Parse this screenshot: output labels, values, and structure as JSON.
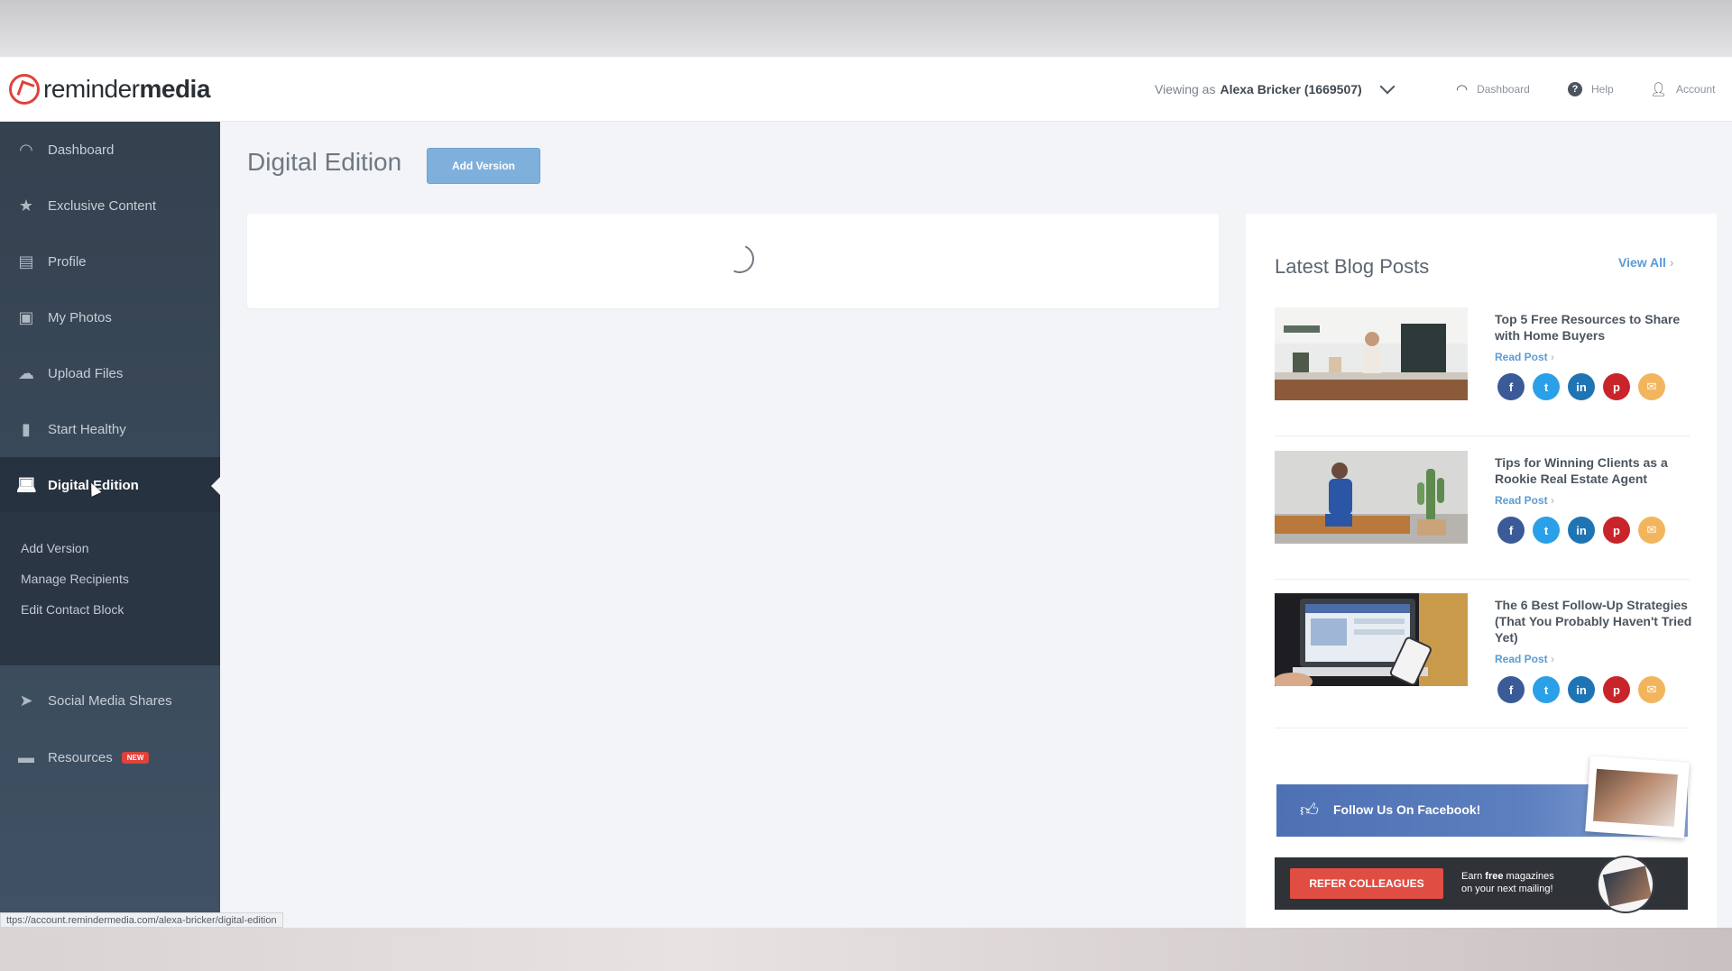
{
  "header": {
    "logo_regular": "reminder",
    "logo_bold": "media",
    "viewing_label": "Viewing as",
    "viewing_user": "Alexa Bricker (1669507)",
    "nav": [
      {
        "label": "Dashboard",
        "icon": "dashboard-gauge-icon"
      },
      {
        "label": "Help",
        "icon": "help-icon"
      },
      {
        "label": "Account",
        "icon": "user-icon"
      }
    ]
  },
  "sidebar": {
    "items": [
      {
        "label": "Dashboard",
        "icon": "dashboard-gauge-icon"
      },
      {
        "label": "Exclusive Content",
        "icon": "star-icon"
      },
      {
        "label": "Profile",
        "icon": "document-icon"
      },
      {
        "label": "My Photos",
        "icon": "photos-icon"
      },
      {
        "label": "Upload Files",
        "icon": "cloud-upload-icon"
      },
      {
        "label": "Start Healthy",
        "icon": "book-icon"
      },
      {
        "label": "Digital Edition",
        "icon": "laptop-icon",
        "active": true
      },
      {
        "label": "Social Media Shares",
        "icon": "paper-plane-icon"
      },
      {
        "label": "Resources",
        "icon": "briefcase-icon",
        "badge": "NEW"
      }
    ],
    "submenu": [
      "Add Version",
      "Manage Recipients",
      "Edit Contact Block"
    ]
  },
  "main": {
    "title": "Digital Edition",
    "add_version_button": "Add Version"
  },
  "blog": {
    "title": "Latest Blog Posts",
    "view_all": "View All",
    "read_post": "Read Post",
    "posts": [
      {
        "title": "Top 5 Free Resources to Share with Home Buyers"
      },
      {
        "title": "Tips for Winning Clients as a Rookie Real Estate Agent"
      },
      {
        "title": "The 6 Best Follow-Up Strategies (That You Probably Haven't Tried Yet)"
      }
    ],
    "social_icons": [
      "facebook-icon",
      "twitter-icon",
      "linkedin-icon",
      "pinterest-icon",
      "email-icon"
    ]
  },
  "banners": {
    "facebook": "Follow Us On Facebook!",
    "refer_button": "REFER COLLEAGUES",
    "refer_line1_pre": "Earn ",
    "refer_line1_bold": "free",
    "refer_line1_post": " magazines",
    "refer_line2": "on your next mailing!"
  },
  "statusbar": {
    "url": "ttps://account.remindermedia.com/alexa-bricker/digital-edition"
  },
  "colors": {
    "sidebar": "#34414f",
    "accent_blue": "#5b9bd5",
    "button_blue": "#7fb0dc",
    "brand_red": "#e0413a"
  }
}
